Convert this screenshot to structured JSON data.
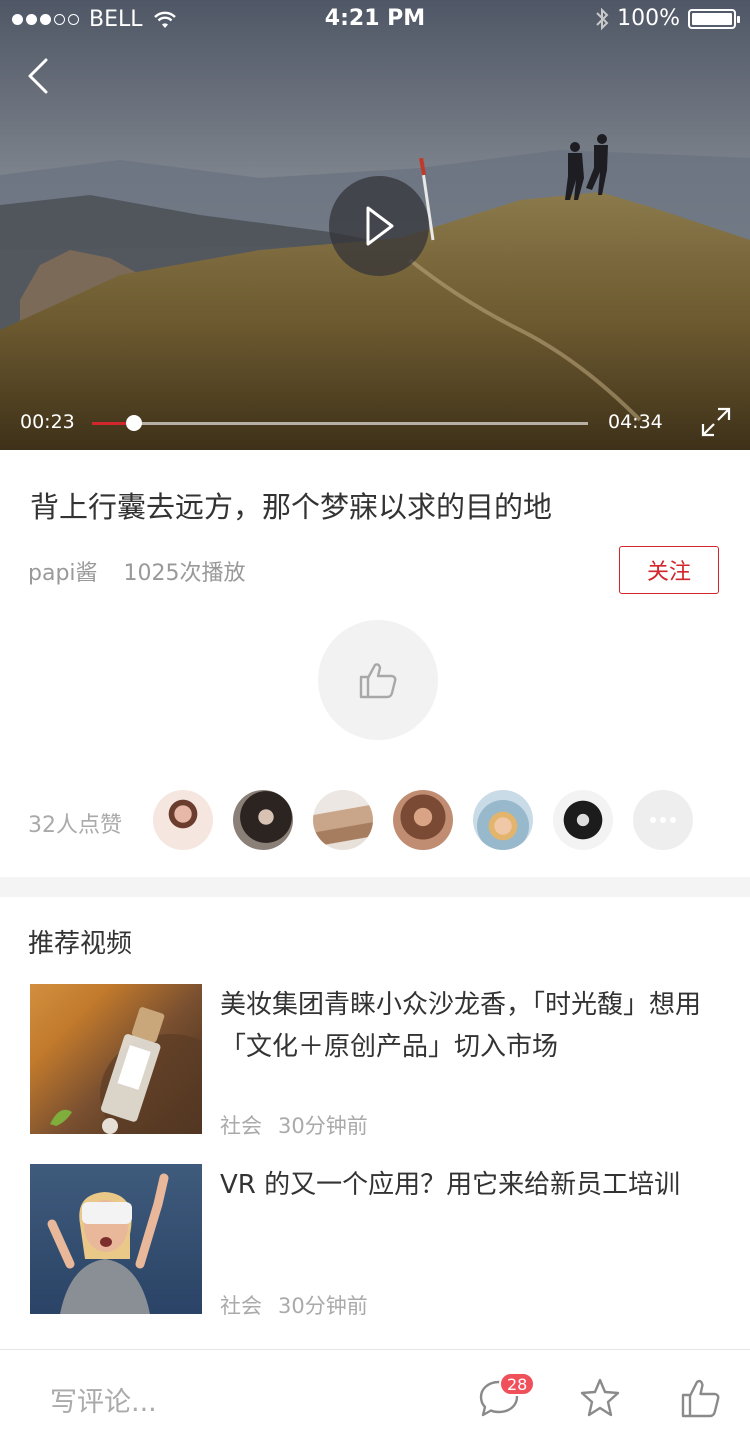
{
  "status_bar": {
    "carrier": "BELL",
    "time": "4:21 PM",
    "battery": "100%",
    "signal_bars_filled": 3,
    "signal_bars_total": 5
  },
  "player": {
    "current_time": "00:23",
    "total_time": "04:34",
    "progress": 0.085,
    "accent_color": "#d0262c"
  },
  "video": {
    "title": "背上行囊去远方，那个梦寐以求的目的地",
    "author": "papi酱",
    "plays": "1025次播放",
    "follow_label": "关注"
  },
  "likes": {
    "count_label": "32人点赞"
  },
  "recommendations": {
    "heading": "推荐视频",
    "items": [
      {
        "title": "美妆集团青睐小众沙龙香，「时光馥」想用「文化＋原创产品」切入市场",
        "category": "社会",
        "time": "30分钟前"
      },
      {
        "title": "VR 的又一个应用？用它来给新员工培训",
        "category": "社会",
        "time": "30分钟前"
      }
    ]
  },
  "bottom_bar": {
    "comment_placeholder": "写评论...",
    "comment_count": "28"
  }
}
